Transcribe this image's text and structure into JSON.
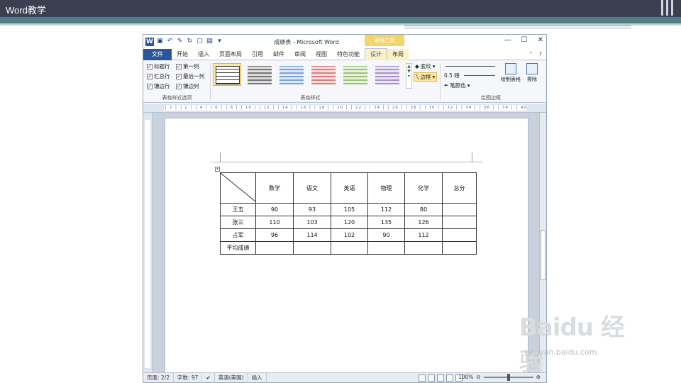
{
  "slide": {
    "title": "Word教学"
  },
  "window": {
    "title": "成绩表 - Microsoft Word",
    "context_tab": "表格工具",
    "controls": [
      "—",
      "☐",
      "✕"
    ]
  },
  "tabs": [
    {
      "label": "文件"
    },
    {
      "label": "开始"
    },
    {
      "label": "插入"
    },
    {
      "label": "页面布局"
    },
    {
      "label": "引用"
    },
    {
      "label": "邮件"
    },
    {
      "label": "审阅"
    },
    {
      "label": "视图"
    },
    {
      "label": "特色功能"
    },
    {
      "label": "设计"
    },
    {
      "label": "布局"
    }
  ],
  "ribbon": {
    "options": {
      "items": [
        {
          "label": "标题行",
          "checked": true
        },
        {
          "label": "第一列",
          "checked": true
        },
        {
          "label": "汇总行",
          "checked": true
        },
        {
          "label": "最后一列",
          "checked": true
        },
        {
          "label": "镶边行",
          "checked": true
        },
        {
          "label": "镶边列",
          "checked": true
        }
      ],
      "group_label": "表格样式选项"
    },
    "styles": {
      "group_label": "表格样式"
    },
    "shading_label": "底纹",
    "borders_label": "边框",
    "line_weight": "0.5 磅",
    "pen_color_label": "笔颜色",
    "draw_table_label": "绘制表格",
    "eraser_label": "擦除",
    "draw_group_label": "绘图边框"
  },
  "ruler": {
    "marks": "│ 2 │ │ 2 │ │ 4 │ │ 6 │ │ 8 │ │ 10 │ │ 12 │ │ 14 │ │ 16 │ │ 18 │ │ 20 │ │ 22 │ │ 24 │ │ 26 │ │ 28 │ │ 30 │ │ 32 │ │ 34 │ │ 36 │ │ 38 │ │ 40 │ │ 42 │ │ 44 │ │ 46 │"
  },
  "table": {
    "headers": [
      "",
      "数学",
      "语文",
      "英语",
      "物理",
      "化学",
      "总分"
    ],
    "rows": [
      [
        "王五",
        "90",
        "93",
        "105",
        "112",
        "80",
        ""
      ],
      [
        "张三",
        "110",
        "103",
        "120",
        "135",
        "126",
        ""
      ],
      [
        "占军",
        "96",
        "114",
        "102",
        "90",
        "112",
        ""
      ],
      [
        "平均成绩",
        "",
        "",
        "",
        "",
        "",
        ""
      ]
    ]
  },
  "status": {
    "page": "页面: 2/2",
    "words": "字数: 97",
    "language": "英语(美国)",
    "mode": "插入",
    "zoom": "100%"
  },
  "watermark": {
    "main": "Baidu 经验",
    "sub": "jingyan.baidu.com"
  }
}
